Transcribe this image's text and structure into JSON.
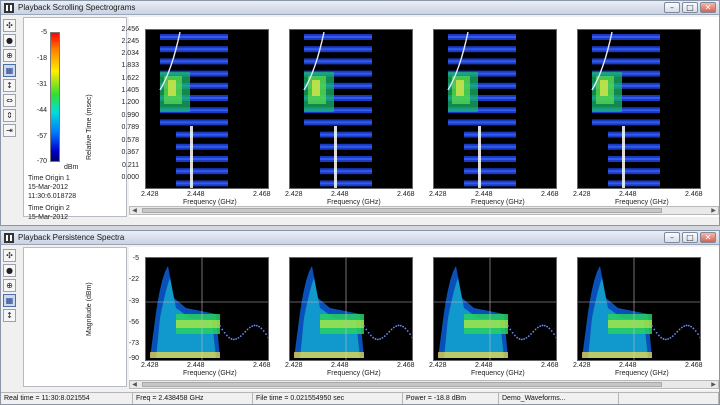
{
  "window1": {
    "title": "Playback Scrolling Spectrograms",
    "buttons": [
      "–",
      "□",
      "✕"
    ],
    "colorbar_ticks": [
      "-5",
      "-18",
      "-31",
      "-44",
      "-57",
      "-70"
    ],
    "colorbar_unit": "dBm",
    "time_origin_1_label": "Time Origin 1",
    "time_origin_1_date": "15-Mar-2012",
    "time_origin_1_time": "11:30:6.018728",
    "time_origin_2_label": "Time Origin 2",
    "time_origin_2_date": "15-Mar-2012",
    "ylabel": "Relative Time (msec)",
    "yticks": [
      "2.456",
      "2.245",
      "2.034",
      "1.833",
      "1.622",
      "1.405",
      "1.200",
      "0.990",
      "0.789",
      "0.578",
      "0.367",
      "0.211",
      "0.000"
    ],
    "xticks": [
      "2.428",
      "2.448",
      "2.468"
    ],
    "xlabel": "Frequency (GHz)"
  },
  "window2": {
    "title": "Playback Persistence Spectra",
    "buttons": [
      "–",
      "□",
      "✕"
    ],
    "ylabel": "Magnitude (dBm)",
    "yticks": [
      "-5",
      "-22",
      "-39",
      "-56",
      "-73",
      "-90"
    ],
    "xticks": [
      "2.428",
      "2.448",
      "2.468"
    ],
    "xlabel": "Frequency (GHz)"
  },
  "toolbar_icons": [
    "pointer-tool-icon",
    "marker-tool-icon",
    "zoom-tool-icon",
    "grid-tool-icon",
    "vertical-zoom-icon",
    "horizontal-zoom-icon",
    "time-zoom-icon",
    "pan-tool-icon"
  ],
  "status": {
    "real_time": "Real time = 11:30:8.021554",
    "freq": "Freq = 2.438458 GHz",
    "file_time": "File time = 0.021554950 sec",
    "power": "Power = -18.8 dBm",
    "file": "Demo_Waveforms..."
  },
  "colors": {
    "plot_bg": "#000000",
    "titlebar": "#c9d3e2"
  }
}
